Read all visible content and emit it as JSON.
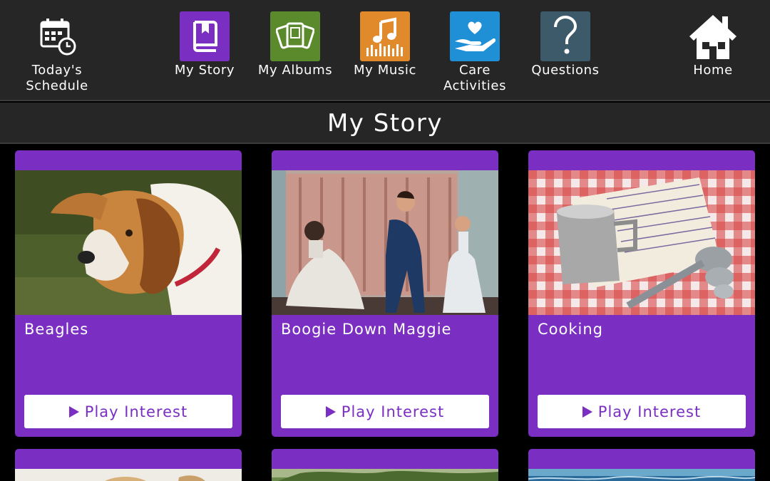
{
  "nav": {
    "items": [
      {
        "label": "Today's\nSchedule",
        "icon": "calendar-clock-icon"
      },
      {
        "label": "My Story",
        "icon": "book-icon",
        "color": "#7b2fc2"
      },
      {
        "label": "My Albums",
        "icon": "photos-icon",
        "color": "#5a8a2c"
      },
      {
        "label": "My Music",
        "icon": "music-note-icon",
        "color": "#e08a2c"
      },
      {
        "label": "Care\nActivities",
        "icon": "hand-heart-icon",
        "color": "#1f8fd6"
      },
      {
        "label": "Questions",
        "icon": "question-mark-icon",
        "color": "#3d5a6a"
      },
      {
        "label": "Home",
        "icon": "house-icon"
      }
    ]
  },
  "page": {
    "title": "My Story"
  },
  "cards": [
    {
      "title": "Beagles",
      "button": "Play Interest"
    },
    {
      "title": "Boogie Down Maggie",
      "button": "Play Interest"
    },
    {
      "title": "Cooking",
      "button": "Play Interest"
    }
  ],
  "colors": {
    "accent": "#7b2fc2",
    "bar": "#262626"
  }
}
